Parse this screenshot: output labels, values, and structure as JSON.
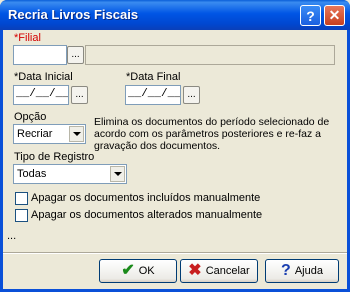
{
  "window": {
    "title": "Recria Livros Fiscais",
    "help_button": "?",
    "close_button": "✕"
  },
  "filial": {
    "label": "*Filial",
    "value": "",
    "lookup_button": "...",
    "description": ""
  },
  "data_inicial": {
    "label": "*Data Inicial",
    "value": "__/__/__",
    "button": "..."
  },
  "data_final": {
    "label": "*Data Final",
    "value": "__/__/__",
    "button": "..."
  },
  "opcao": {
    "label": "Opção",
    "selected": "Recriar",
    "description": "Elimina os documentos do  período selecionado de acordo com os parâmetros posteriores e re-faz a gravação dos documentos."
  },
  "tipo_registro": {
    "label": "Tipo de Registro",
    "selected": "Todas"
  },
  "checkboxes": [
    {
      "label": "Apagar os documentos incluídos manualmente",
      "checked": false
    },
    {
      "label": "Apagar os documentos alterados manualmente",
      "checked": false
    }
  ],
  "status": "...",
  "buttons": {
    "ok": "OK",
    "cancelar": "Cancelar",
    "ajuda": "Ajuda"
  },
  "colors": {
    "required_label": "#d40000",
    "ok_icon": "#1a8a1a",
    "cancel_icon": "#c81e1e",
    "help_icon": "#1a3fb0"
  }
}
